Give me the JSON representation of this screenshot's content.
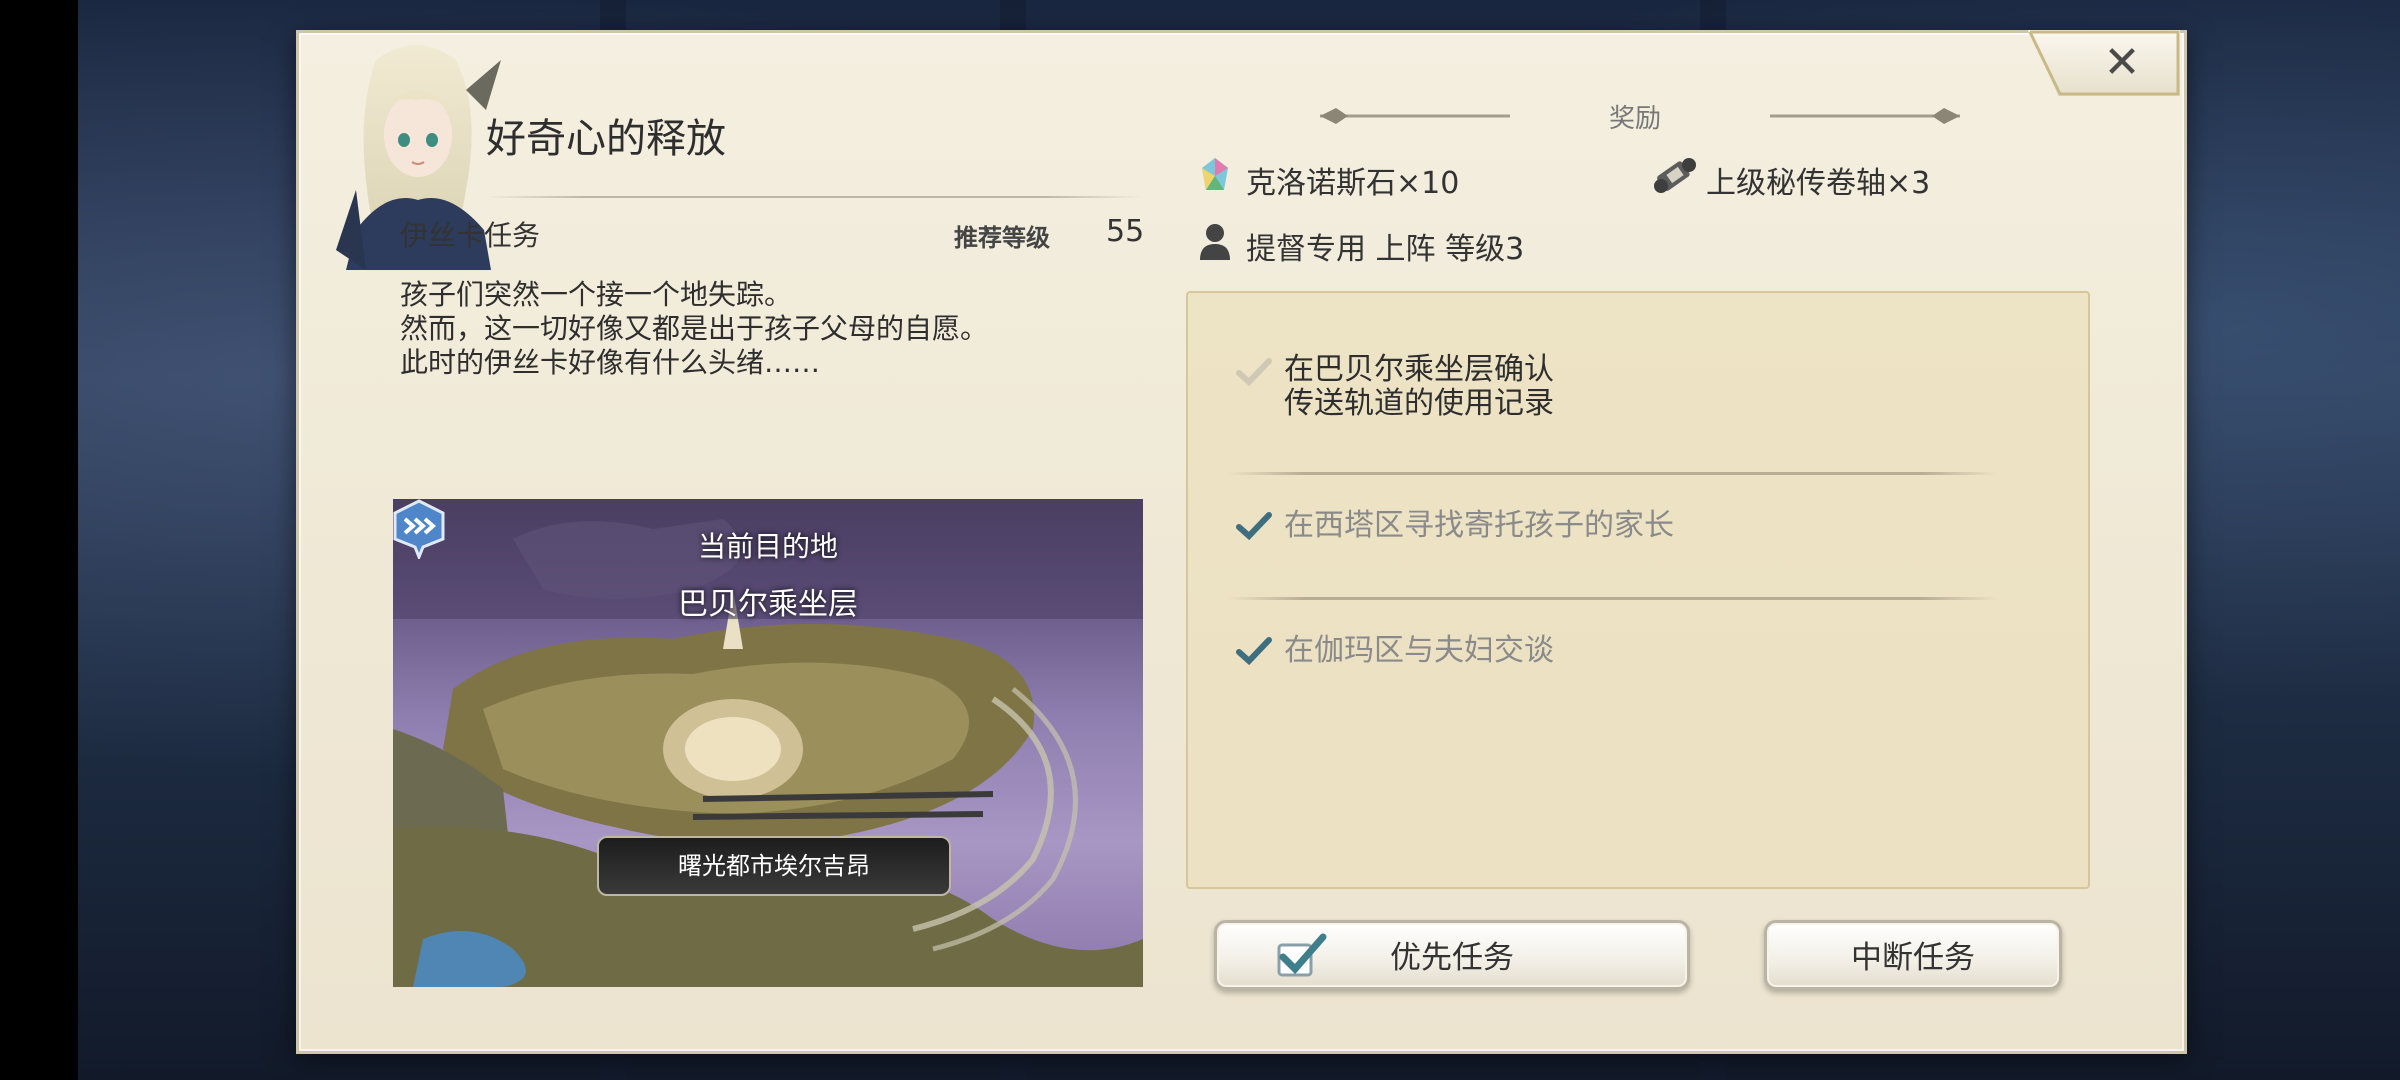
{
  "quest": {
    "title": "好奇心的释放",
    "giver": "伊丝卡任务",
    "recommended_level_label": "推荐等级",
    "recommended_level": "55",
    "description": [
      "孩子们突然一个接一个地失踪。",
      "然而，这一切好像又都是出于孩子父母的自愿。",
      "此时的伊丝卡好像有什么头绪……"
    ]
  },
  "map": {
    "destination_label": "当前目的地",
    "destination_name": "巴贝尔乘坐层",
    "city_name": "曙光都市埃尔吉昂",
    "marker_icon": "forward-arrows-icon"
  },
  "rewards": {
    "title": "奖励",
    "items": [
      {
        "icon": "crystal-icon",
        "label": "克洛诺斯石×10"
      },
      {
        "icon": "scroll-icon",
        "label": "上级秘传卷轴×3"
      },
      {
        "icon": "person-icon",
        "label": "提督专用 上阵 等级3"
      }
    ]
  },
  "objectives": [
    {
      "lines": [
        "在巴贝尔乘坐层确认",
        "传送轨道的使用记录"
      ],
      "status": "current"
    },
    {
      "lines": [
        "在西塔区寻找寄托孩子的家长"
      ],
      "status": "done"
    },
    {
      "lines": [
        "在伽玛区与夫妇交谈"
      ],
      "status": "done"
    }
  ],
  "buttons": {
    "priority": "优先任务",
    "abandon": "中断任务"
  },
  "colors": {
    "panel": "#f1ebda",
    "objective_box": "#ece2c3",
    "check_done": "#3f6f7f",
    "check_current": "#c9c3b4",
    "text_done": "#8a8a8a",
    "text_current": "#2e2e2e"
  }
}
